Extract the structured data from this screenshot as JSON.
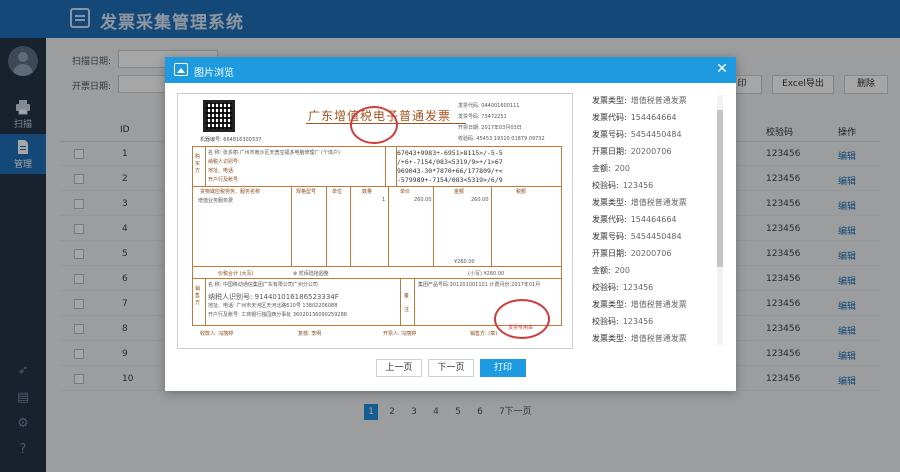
{
  "app": {
    "title": "发票采集管理系统"
  },
  "sidebar": {
    "items": [
      {
        "label": "扫描",
        "icon": "printer-icon"
      },
      {
        "label": "管理",
        "icon": "document-icon"
      }
    ],
    "bottom_icons": [
      "rocket-icon",
      "book-icon",
      "gear-icon",
      "help-icon"
    ]
  },
  "filters": {
    "scan_date_label": "扫描日期:",
    "issue_date_label": "开票日期:"
  },
  "toolbar": {
    "print_label": "印",
    "excel_label": "Excel导出",
    "delete_label": "删除"
  },
  "table": {
    "headers": {
      "id": "ID",
      "code": "校验码",
      "action": "操作"
    },
    "rows": [
      {
        "id": "1",
        "code": "123456",
        "action": "编辑"
      },
      {
        "id": "2",
        "code": "123456",
        "action": "编辑"
      },
      {
        "id": "3",
        "code": "123456",
        "action": "编辑"
      },
      {
        "id": "4",
        "code": "123456",
        "action": "编辑"
      },
      {
        "id": "5",
        "code": "123456",
        "action": "编辑"
      },
      {
        "id": "6",
        "code": "123456",
        "action": "编辑"
      },
      {
        "id": "7",
        "code": "123456",
        "action": "编辑"
      },
      {
        "id": "8",
        "code": "123456",
        "action": "编辑"
      },
      {
        "id": "9",
        "code": "123456",
        "action": "编辑"
      },
      {
        "id": "10",
        "code": "123456",
        "action": "编辑"
      }
    ]
  },
  "pagination": {
    "pages": [
      "1",
      "2",
      "3",
      "4",
      "5",
      "6",
      "7"
    ],
    "current": "1",
    "next_label": "下一页"
  },
  "modal": {
    "title": "图片浏览",
    "info": [
      {
        "k": "发票类型:",
        "v": "增值税普通发票"
      },
      {
        "k": "发票代码:",
        "v": "154464664"
      },
      {
        "k": "发票号码:",
        "v": "5454450484"
      },
      {
        "k": "开票日期:",
        "v": "20200706"
      },
      {
        "k": "金额:",
        "v": "200"
      },
      {
        "k": "校验码:",
        "v": "123456"
      },
      {
        "k": "发票类型:",
        "v": "增值税普通发票"
      },
      {
        "k": "发票代码:",
        "v": "154464664"
      },
      {
        "k": "发票号码:",
        "v": "5454450484"
      },
      {
        "k": "开票日期:",
        "v": "20200706"
      },
      {
        "k": "金额:",
        "v": "200"
      },
      {
        "k": "校验码:",
        "v": "123456"
      },
      {
        "k": "发票类型:",
        "v": "增值税普通发票"
      },
      {
        "k": "校验码:",
        "v": "123456"
      },
      {
        "k": "发票类型:",
        "v": "增值税普通发票"
      }
    ],
    "buttons": {
      "prev": "上一页",
      "next": "下一页",
      "print": "打印"
    }
  },
  "invoice": {
    "title": "广东增值税电子普通发票",
    "machine_no": "机器编号: 664816300337",
    "code_label": "发票代码: 044001600111",
    "number_label": "发票号码: 73472251",
    "date_label": "开票日期: 2017年03月03日",
    "check_label": "校验码: 45453 19310 01879 09732",
    "buyer_side": "购买方",
    "buyer_name": "名 称: 张多丽·广州市南沙区天宽宝福多电脑修理厂 (个体户)",
    "buyer_tax": "纳税人识别号:",
    "buyer_addr": "地址、电话:",
    "buyer_bank": "开户行及账号:",
    "cipher": "67043+9983+-6951>8115>/-5-5\n/+6+-7154/083<5319/9>+/1>67\n969043-30*7870+66/177809/+<\n-579989+-7154/083<5319>/6/9",
    "item_header": "货物或应税劳务、服务名称",
    "spec_header": "规格型号",
    "unit_header": "单位",
    "qty_header": "数量",
    "price_header": "单价",
    "amount_header": "金额",
    "tax_header": "税额",
    "item_name": "增值业务服务费",
    "qty": "1",
    "price": "260.00",
    "amount": "260.00",
    "total_amount": "¥260.00",
    "sum_label": "价税合计 (大写)",
    "sum_words": "⊗ 贰佰陆拾圆整",
    "sum_small": "(小写) ¥260.00",
    "seller_side": "销售方",
    "seller_name": "名 称: 中国移动通信集团广东有限公司广州分公司",
    "seller_tax": "纳税人识别号: 914401016186523334F",
    "seller_addr": "地址、电话: 广州市天河区天河北路610号 13802206088",
    "seller_bank": "开户行及账号: 工商银行独园西分事处 36020136090259288",
    "note_label": "备 注",
    "note_text": "集团产品号码:301201001101 计费月份:2017年01月",
    "payee": "收款人: 冯丽婷",
    "reviewer": "复核: 李明",
    "drawer": "开票人: 冯丽婷",
    "seller_sign": "销售方: (章)",
    "seal_text": "发票专用章"
  }
}
